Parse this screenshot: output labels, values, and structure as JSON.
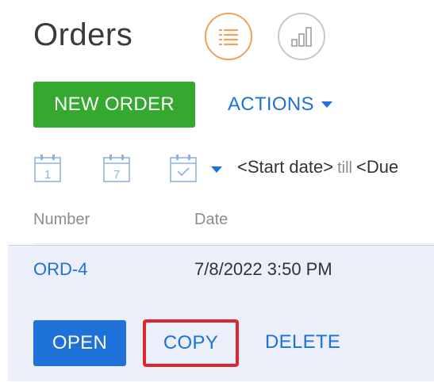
{
  "page": {
    "title": "Orders"
  },
  "view_toggle": {
    "list_icon": "list-icon",
    "chart_icon": "bar-chart-icon",
    "active": "list"
  },
  "toolbar": {
    "new_order_label": "NEW ORDER",
    "actions_label": "ACTIONS"
  },
  "filters": {
    "day_icon_label": "1",
    "week_icon_label": "7",
    "period_start": "<Start date>",
    "period_till": "till",
    "period_due": "<Due"
  },
  "grid": {
    "columns": [
      "Number",
      "Date"
    ],
    "selected_row": {
      "number": "ORD-4",
      "date": "7/8/2022 3:50 PM"
    },
    "row_actions": {
      "open": "OPEN",
      "copy": "COPY",
      "delete": "DELETE"
    }
  },
  "colors": {
    "accent_blue": "#1d71d8",
    "new_order_green": "#35a82f",
    "list_toggle_orange": "#f3a05a",
    "highlight_red": "#e0262f",
    "selected_row_bg": "#eaeffa"
  }
}
